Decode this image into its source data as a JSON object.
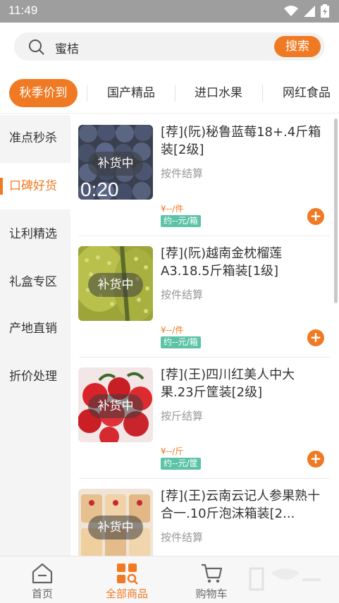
{
  "status_bar": {
    "time": "11:49"
  },
  "search": {
    "query": "蜜桔",
    "button_label": "搜索"
  },
  "category_tabs": [
    {
      "label": "秋季价到",
      "active": true
    },
    {
      "label": "国产精品",
      "active": false
    },
    {
      "label": "进口水果",
      "active": false
    },
    {
      "label": "网红食品",
      "active": false
    }
  ],
  "sidebar": {
    "items": [
      {
        "label": "准点秒杀",
        "active": false
      },
      {
        "label": "口碑好货",
        "active": true
      },
      {
        "label": "让利精选",
        "active": false
      },
      {
        "label": "礼盒专区",
        "active": false
      },
      {
        "label": "产地直销",
        "active": false
      },
      {
        "label": "折价处理",
        "active": false
      }
    ]
  },
  "products": [
    {
      "title": "[荐](阮)秘鲁蓝莓18+.4斤箱装[2级]",
      "subtitle": "按件结算",
      "price": "¥--/件",
      "tag": "约--元/箱",
      "overlay": "补货中",
      "countdown": "0:20"
    },
    {
      "title": "[荐](阮)越南金枕榴莲A3.18.5斤箱装[1级]",
      "subtitle": "按件结算",
      "price": "¥--/件",
      "tag": "约--元/箱",
      "overlay": "补货中"
    },
    {
      "title": "[荐](王)四川红美人中大果.23斤筐装[2级]",
      "subtitle": "按斤结算",
      "price": "¥--/斤",
      "tag": "约--元/筐",
      "overlay": "补货中"
    },
    {
      "title": "[荐](王)云南云记人参果熟十合一.10斤泡沫箱装[2...",
      "subtitle": "按件结算",
      "overlay": "补货中"
    }
  ],
  "bottom_nav": [
    {
      "label": "首页",
      "icon": "home-icon",
      "active": false
    },
    {
      "label": "全部商品",
      "icon": "grid-search-icon",
      "active": true
    },
    {
      "label": "购物车",
      "icon": "cart-icon",
      "active": false
    }
  ],
  "colors": {
    "accent": "#f07a23",
    "tag": "#5cc3a7"
  }
}
